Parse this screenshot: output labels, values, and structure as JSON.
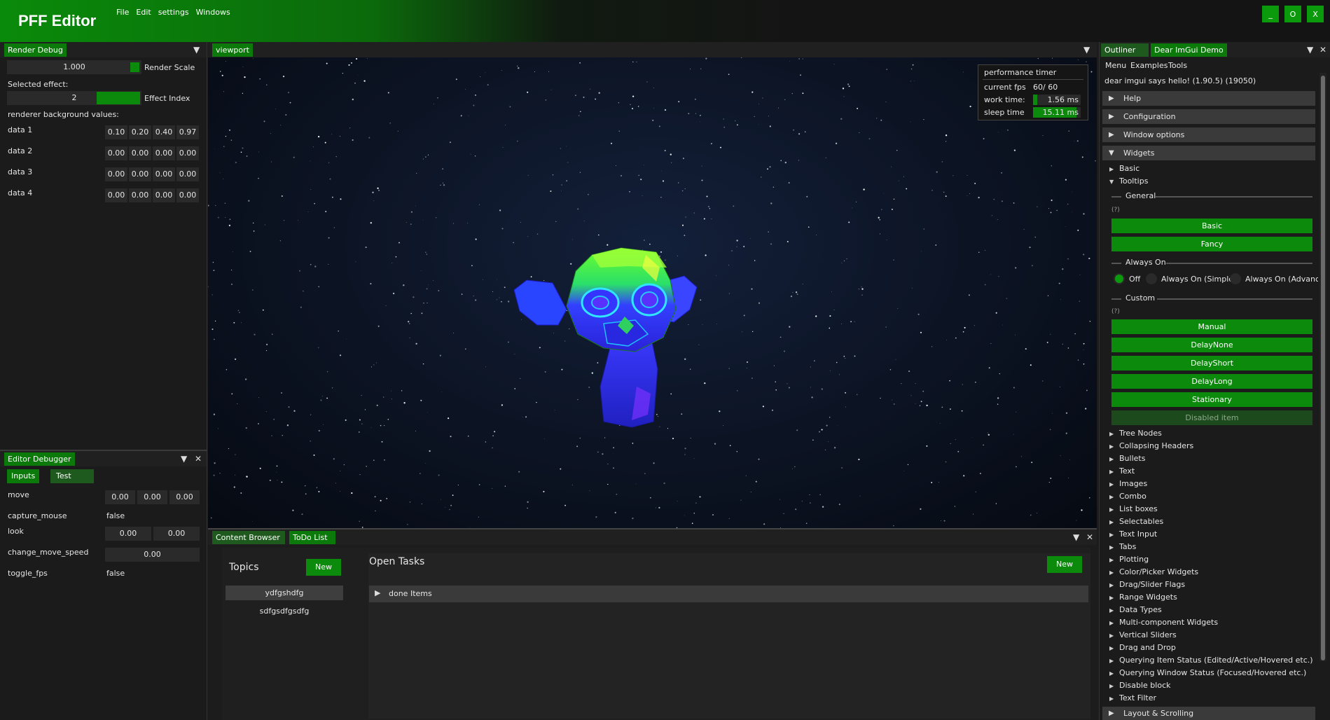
{
  "app": {
    "title": "PFF Editor",
    "menu": [
      "File",
      "Edit",
      "settings",
      "Windows"
    ],
    "window_buttons": [
      "_",
      "O",
      "X"
    ]
  },
  "render_debug": {
    "tab": "Render Debug",
    "render_scale_value": "1.000",
    "render_scale_label": "Render Scale",
    "selected_effect_label": "Selected effect:",
    "effect_index_value": "2",
    "effect_index_label": "Effect Index",
    "bg_values_label": "renderer background values:",
    "rows": [
      {
        "label": "data 1",
        "values": [
          "0.10",
          "0.20",
          "0.40",
          "0.97"
        ]
      },
      {
        "label": "data 2",
        "values": [
          "0.00",
          "0.00",
          "0.00",
          "0.00"
        ]
      },
      {
        "label": "data 3",
        "values": [
          "0.00",
          "0.00",
          "0.00",
          "0.00"
        ]
      },
      {
        "label": "data 4",
        "values": [
          "0.00",
          "0.00",
          "0.00",
          "0.00"
        ]
      }
    ]
  },
  "editor_debugger": {
    "tab": "Editor Debugger",
    "subtabs": [
      "Inputs",
      "Test"
    ],
    "move": {
      "label": "move",
      "values": [
        "0.00",
        "0.00",
        "0.00"
      ]
    },
    "capture_mouse": {
      "label": "capture_mouse",
      "value": "false"
    },
    "look": {
      "label": "look",
      "values": [
        "0.00",
        "0.00"
      ]
    },
    "change_move_speed": {
      "label": "change_move_speed",
      "value": "0.00"
    },
    "toggle_fps": {
      "label": "toggle_fps",
      "value": "false"
    }
  },
  "viewport": {
    "tab": "viewport",
    "perf": {
      "title": "performance timer",
      "fps_label": "current fps",
      "fps_value": "60/ 60",
      "work_label": "work time:",
      "work_value": "1.56 ms",
      "work_fraction": 0.09,
      "sleep_label": "sleep time",
      "sleep_value": "15.11 ms",
      "sleep_fraction": 0.91
    }
  },
  "bottom": {
    "tabs": [
      "Content Browser",
      "ToDo List"
    ],
    "topics_title": "Topics",
    "new_label": "New",
    "topics": [
      "ydfgshdfg",
      "sdfgsdfgsdfg"
    ],
    "open_tasks_title": "Open Tasks",
    "done_items": "done Items"
  },
  "right": {
    "tabs": [
      "Outliner",
      "Dear ImGui Demo"
    ],
    "menu": [
      "Menu",
      "Examples",
      "Tools"
    ],
    "hello": "dear imgui says hello! (1.90.5) (19050)",
    "headers": [
      "Help",
      "Configuration",
      "Window options",
      "Widgets"
    ],
    "basic": "Basic",
    "tooltips": "Tooltips",
    "general": "General",
    "help_marker": "(?)",
    "general_buttons": [
      "Basic",
      "Fancy"
    ],
    "always_on": "Always On",
    "radios": [
      "Off",
      "Always On (Simple)",
      "Always On (Advanced)"
    ],
    "custom": "Custom",
    "custom_buttons": [
      "Manual",
      "DelayNone",
      "DelayShort",
      "DelayLong",
      "Stationary"
    ],
    "disabled_button": "Disabled item",
    "tree_items": [
      "Tree Nodes",
      "Collapsing Headers",
      "Bullets",
      "Text",
      "Images",
      "Combo",
      "List boxes",
      "Selectables",
      "Text Input",
      "Tabs",
      "Plotting",
      "Color/Picker Widgets",
      "Drag/Slider Flags",
      "Range Widgets",
      "Data Types",
      "Multi-component Widgets",
      "Vertical Sliders",
      "Drag and Drop",
      "Querying Item Status (Edited/Active/Hovered etc.)",
      "Querying Window Status (Focused/Hovered etc.)",
      "Disable block",
      "Text Filter"
    ],
    "last_header": "Layout & Scrolling"
  },
  "colors": {
    "accent": "#0b8a0b",
    "panel": "#1b1b1b",
    "space": "#0d1526"
  },
  "icons": {
    "menu": "menu-down-icon",
    "close": "close-icon",
    "arrow": "triangle-icon"
  }
}
